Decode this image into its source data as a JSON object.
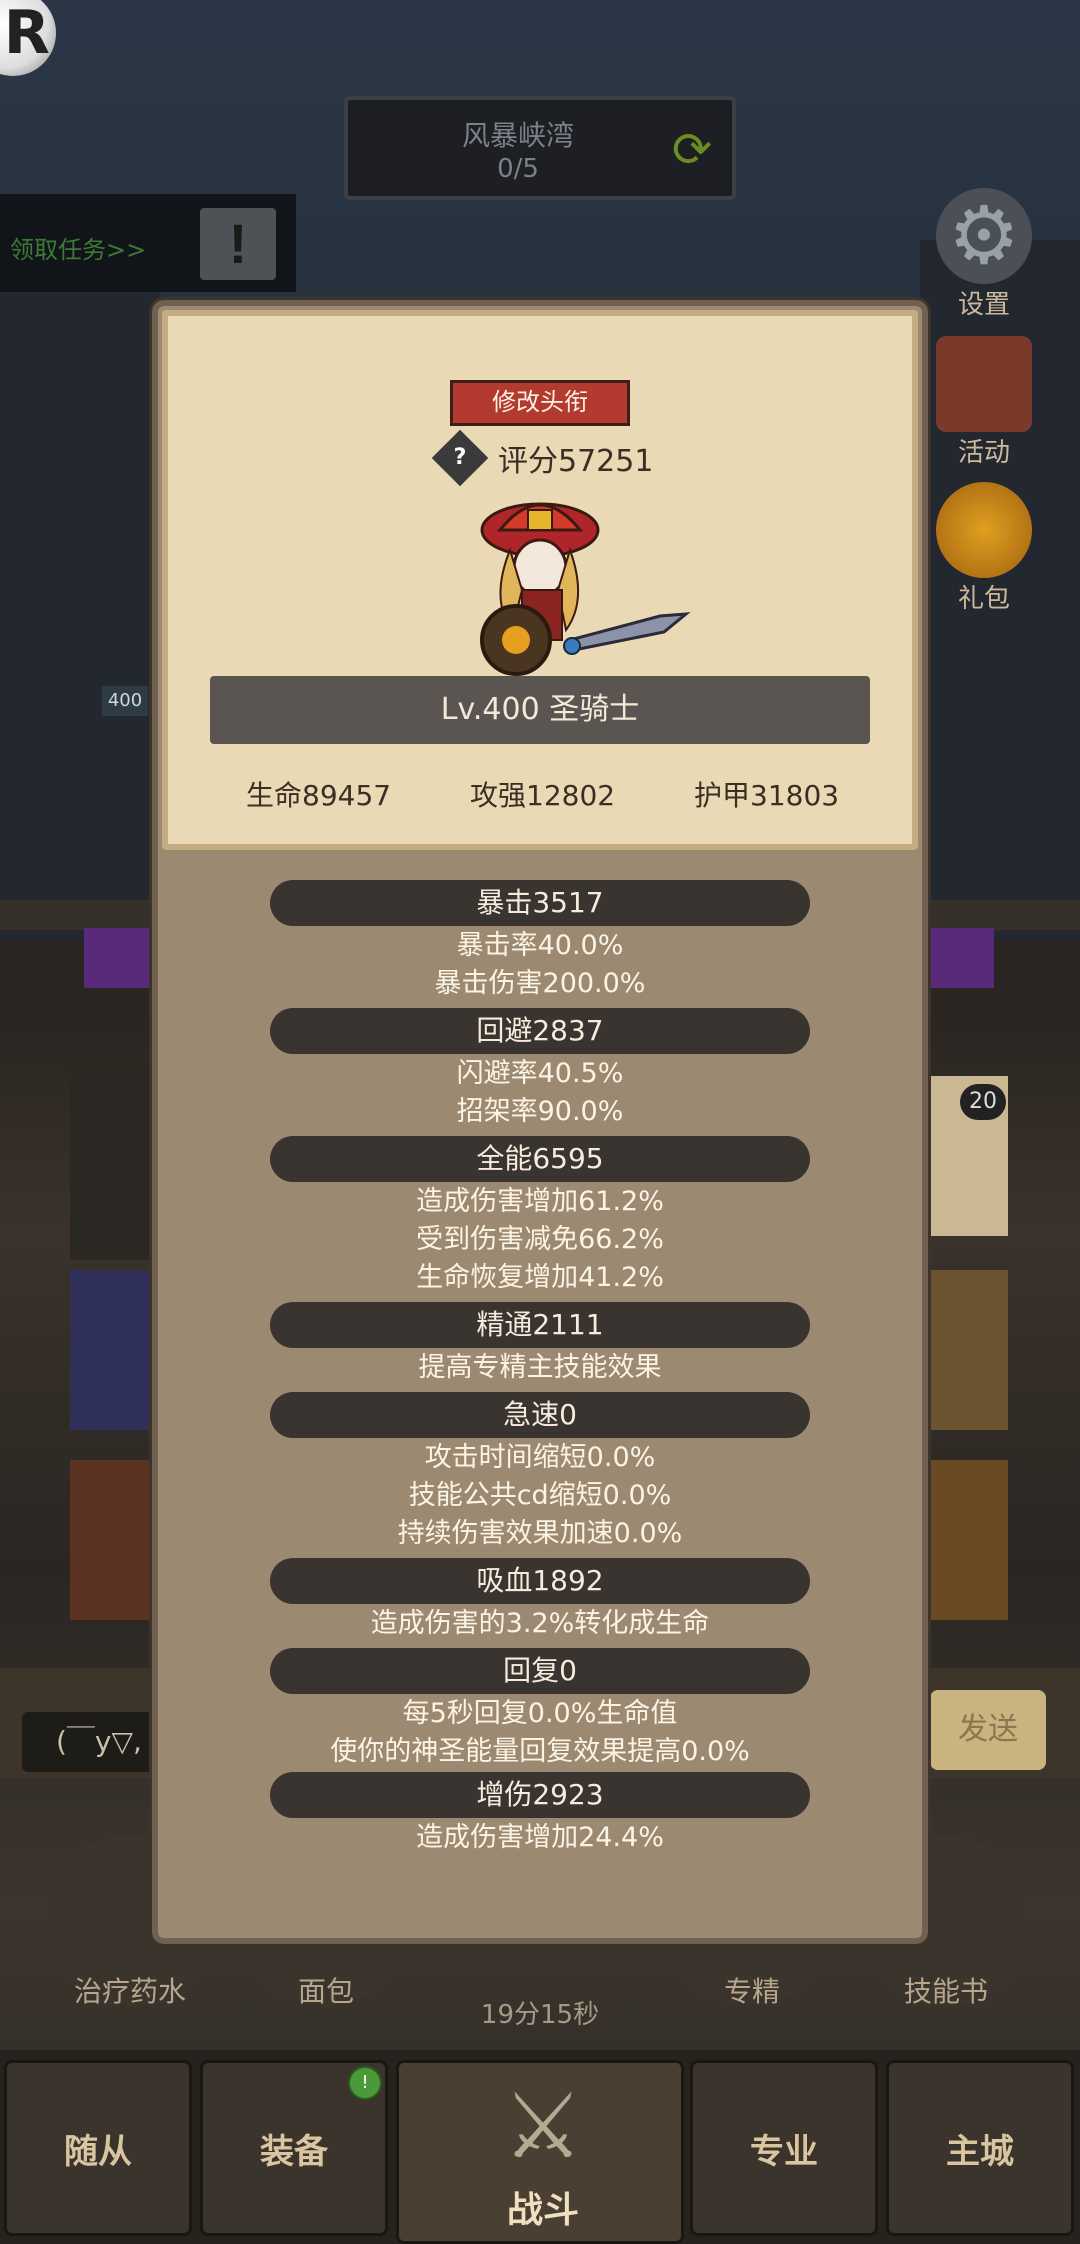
{
  "top": {
    "logo_letter": "R",
    "stage_name": "风暴峡湾",
    "stage_progress": "0/5",
    "quest_text": "领取任务>>",
    "quest_icon": "!"
  },
  "side_menu": [
    {
      "label": "设置",
      "icon": "gear-icon"
    },
    {
      "label": "活动",
      "icon": "calendar-icon"
    },
    {
      "label": "礼包",
      "icon": "gift-icon"
    }
  ],
  "panel": {
    "title_button": "修改头衔",
    "score_icon": "?",
    "score": "评分57251",
    "level_title": "Lv.400 圣骑士",
    "hp": "生命89457",
    "attack": "攻强12802",
    "armor": "护甲31803",
    "stats": [
      {
        "header": "暴击3517",
        "lines": [
          "暴击率40.0%",
          "暴击伤害200.0%"
        ]
      },
      {
        "header": "回避2837",
        "lines": [
          "闪避率40.5%",
          "招架率90.0%"
        ]
      },
      {
        "header": "全能6595",
        "lines": [
          "造成伤害增加61.2%",
          "受到伤害减免66.2%",
          "生命恢复增加41.2%"
        ]
      },
      {
        "header": "精通2111",
        "lines": [
          "提高专精主技能效果"
        ]
      },
      {
        "header": "急速0",
        "lines": [
          "攻击时间缩短0.0%",
          "技能公共cd缩短0.0%",
          "持续伤害效果加速0.0%"
        ]
      },
      {
        "header": "吸血1892",
        "lines": [
          "造成伤害的3.2%转化成生命"
        ]
      },
      {
        "header": "回复0",
        "lines": [
          "每5秒回复0.0%生命值",
          "使你的神圣能量回复效果提高0.0%"
        ]
      },
      {
        "header": "增伤2923",
        "lines": [
          "造成伤害增加24.4%"
        ]
      }
    ]
  },
  "background": {
    "level_badge": "400",
    "item_badge": "20",
    "chat_text": "(￣y▽,",
    "send_label": "发送",
    "timer": "19分15秒",
    "items": [
      "治疗药水",
      "面包",
      "专精",
      "技能书"
    ]
  },
  "bottom_nav": {
    "followers": "随从",
    "equipment": "装备",
    "battle": "战斗",
    "profession": "专业",
    "main_city": "主城",
    "notice_badge": "!"
  },
  "colors": {
    "panel_bg": "#9c8972",
    "parchment": "#ead9b5",
    "header_pill": "#3a3430",
    "title_red": "#b23a2e"
  }
}
